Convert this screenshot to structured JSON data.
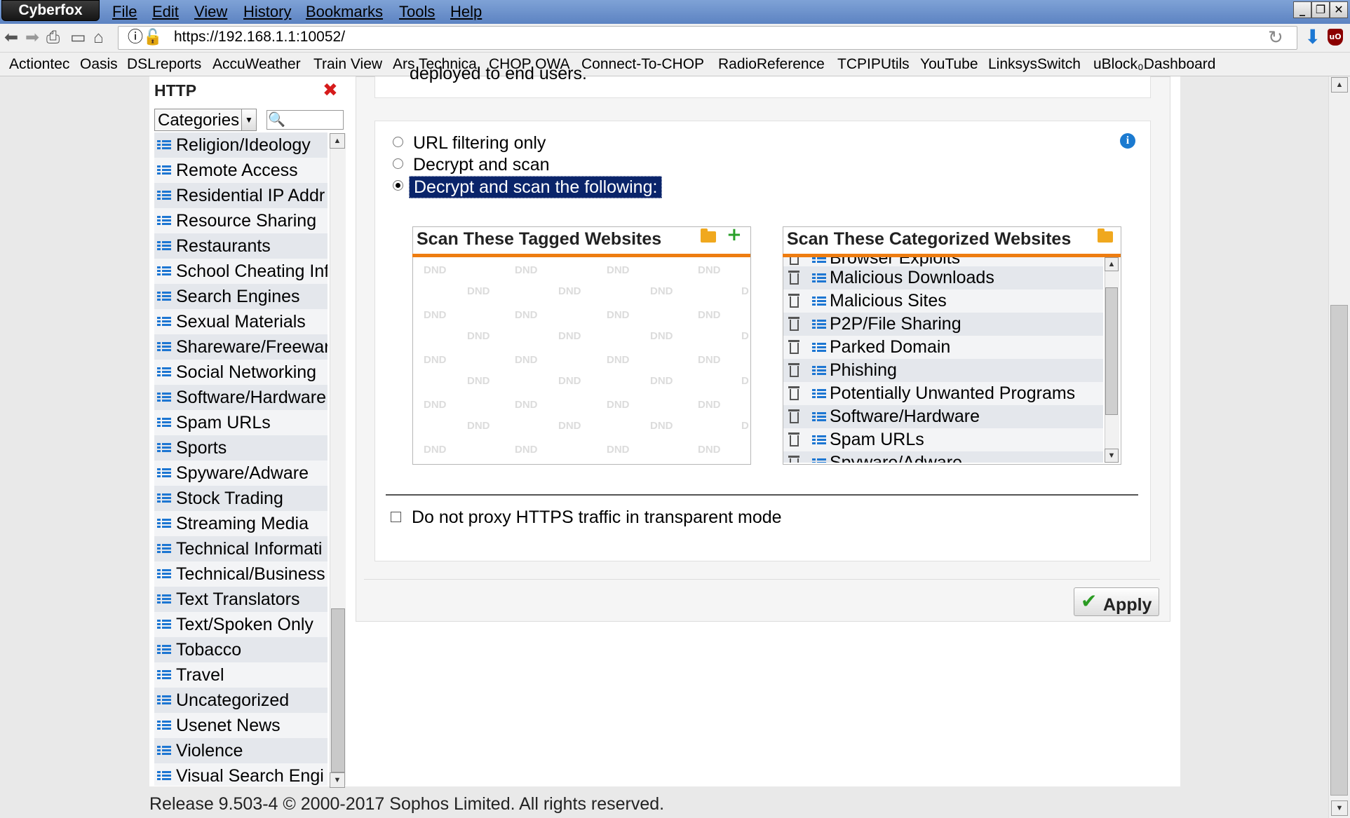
{
  "window": {
    "brand": "Cyberfox",
    "menu": [
      "File",
      "Edit",
      "View",
      "History",
      "Bookmarks",
      "Tools",
      "Help"
    ],
    "controls": {
      "minimize": "_",
      "restore": "❐",
      "close": "✕"
    }
  },
  "navbar": {
    "url": "https://192.168.1.1:10052/",
    "icons": [
      "back-icon",
      "forward-icon",
      "print-icon",
      "window-icon",
      "home-icon",
      "info-icon",
      "lock-warning-icon",
      "reload-icon",
      "download-icon",
      "ublock-icon"
    ]
  },
  "bookmarks": [
    "Actiontec",
    "Oasis",
    "DSLreports",
    "AccuWeather",
    "Train View",
    "Ars Technica",
    "CHOP OWA",
    "Connect-To-CHOP",
    "RadioReference",
    "TCPIPUtils",
    "YouTube",
    "LinksysSwitch",
    "uBlock₀Dashboard"
  ],
  "sidebar": {
    "title": "HTTP",
    "select_value": "Categories",
    "search_placeholder": "",
    "items": [
      "Religion/Ideology",
      "Remote Access",
      "Residential IP Addr",
      "Resource Sharing",
      "Restaurants",
      "School Cheating Inf",
      "Search Engines",
      "Sexual Materials",
      "Shareware/Freewar",
      "Social Networking",
      "Software/Hardware",
      "Spam URLs",
      "Sports",
      "Spyware/Adware",
      "Stock Trading",
      "Streaming Media",
      "Technical Informati",
      "Technical/Business",
      "Text Translators",
      "Text/Spoken Only",
      "Tobacco",
      "Travel",
      "Uncategorized",
      "Usenet News",
      "Violence",
      "Visual Search Engi"
    ]
  },
  "content": {
    "top_fragment": "deployed to end users.",
    "radios": [
      {
        "label": "URL filtering only",
        "selected": false
      },
      {
        "label": "Decrypt and scan",
        "selected": false
      },
      {
        "label": "Decrypt and scan the following:",
        "selected": true
      }
    ],
    "tagged_panel": {
      "title": "Scan These Tagged Websites",
      "watermark": "DND"
    },
    "categorized_panel": {
      "title": "Scan These Categorized Websites",
      "items": [
        "Browser Exploits",
        "Malicious Downloads",
        "Malicious Sites",
        "P2P/File Sharing",
        "Parked Domain",
        "Phishing",
        "Potentially Unwanted Programs",
        "Software/Hardware",
        "Spam URLs",
        "Spyware/Adware"
      ]
    },
    "checkbox_label": "Do not proxy HTTPS traffic in transparent mode",
    "checkbox_checked": false,
    "apply_label": "Apply"
  },
  "footer": "Release 9.503-4  © 2000-2017 Sophos Limited. All rights reserved.",
  "colors": {
    "accent_orange": "#ee7d11",
    "list_icon_blue": "#1d76d2",
    "selection_navy": "#0a246a",
    "apply_green": "#2a9b22",
    "close_red": "#d61b1b"
  }
}
